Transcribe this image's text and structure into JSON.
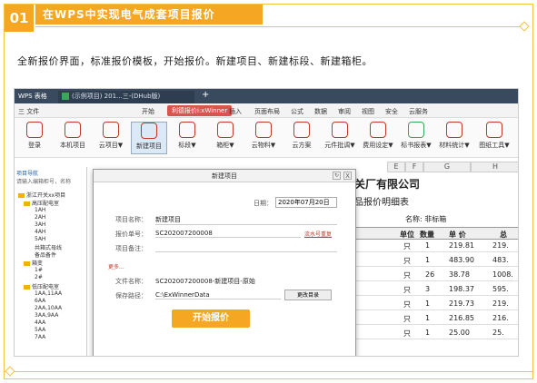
{
  "section": {
    "number": "01",
    "title": "在WPS中实现电气成套项目报价"
  },
  "intro": "全新报价界面，标准报价模板，开始报价。新建项目、新建标段、新建箱柜。",
  "app": {
    "name": "WPS 表格",
    "doc_tab": "(示例项目) 201...三-(DHub版)",
    "new_tab": "+"
  },
  "menu": {
    "items": [
      "三 文件",
      "开始",
      "利德报价i:xWinner",
      "插入",
      "页面布局",
      "公式",
      "数据",
      "审阅",
      "视图",
      "安全",
      "云服务"
    ]
  },
  "ribbon": {
    "buttons": [
      "登录",
      "本机项目",
      "云项目▼",
      "新建项目",
      "标段▼",
      "箱柜▼",
      "云物料▼",
      "云方案",
      "元件批调▼",
      "费用设定▼",
      "标书报表▼",
      "材料统计▼",
      "图纸工具▼"
    ]
  },
  "nav": {
    "title": "项目导航",
    "search": "请输入编箱柜号，名称",
    "items": [
      "浙江开关xx项目",
      "高压配电室",
      "1AH",
      "2AH",
      "3AH",
      "4AH",
      "5AH",
      "共箱式母线",
      "备品备件",
      "箱变",
      "1#",
      "2#",
      "低压配电室",
      "1AA,11AA",
      "6AA",
      "2AA,10AA",
      "3AA,9AA",
      "4AA",
      "5AA",
      "7AA"
    ]
  },
  "sheet": {
    "cols": [
      "E",
      "F",
      "G",
      "H"
    ],
    "company": "关开关厂有限公司",
    "subtitle": "套产品报价明细表",
    "row_left": "F",
    "name_label": "名称: 非标箱",
    "header": [
      "厂家",
      "单位",
      "数量",
      "单 价",
      "总"
    ],
    "rows": [
      {
        "unit": "只",
        "qty": "1",
        "price": "219.81",
        "total": "219."
      },
      {
        "unit": "只",
        "qty": "1",
        "price": "483.90",
        "total": "483."
      },
      {
        "unit": "只",
        "qty": "26",
        "price": "38.78",
        "total": "1008."
      },
      {
        "unit": "只",
        "qty": "3",
        "price": "198.37",
        "total": "595."
      },
      {
        "unit": "只",
        "qty": "1",
        "price": "219.73",
        "total": "219."
      },
      {
        "unit": "只",
        "qty": "1",
        "price": "216.85",
        "total": "216."
      },
      {
        "unit": "只",
        "qty": "1",
        "price": "25.00",
        "total": "25."
      }
    ]
  },
  "dialog": {
    "title": "新建项目",
    "close": "X",
    "date_label": "日期：",
    "date_value": "2020年07月20日",
    "fields": [
      {
        "label": "项目名称：",
        "value": "新建项目"
      },
      {
        "label": "报价单号：",
        "value": "SC202007200008"
      },
      {
        "label": "项目备注：",
        "value": ""
      }
    ],
    "link": "流水号重复",
    "more": "更多...",
    "filename_label": "文件名称：",
    "filename_value": "SC202007200008-新建项目-原始",
    "path_label": "保存路径：",
    "path_value": "C:\\ExWinnerData",
    "change_dir": "更改目录",
    "start": "开始报价"
  }
}
